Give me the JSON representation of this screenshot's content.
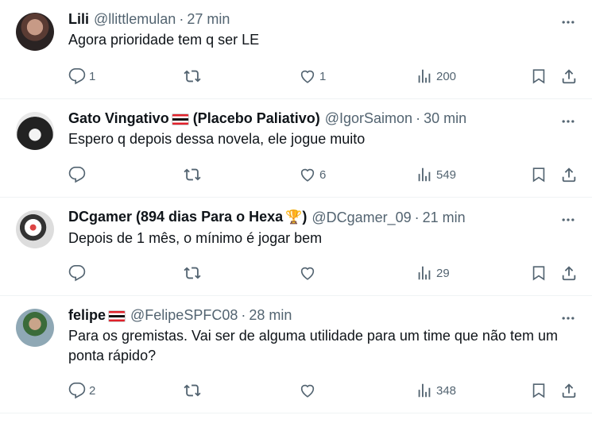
{
  "tweets": [
    {
      "name": "Lili",
      "name_suffix": "",
      "handle": "@llittlemulan",
      "time": "27 min",
      "text": "Agora prioridade tem q ser LE",
      "replies": "1",
      "retweets": "",
      "likes": "1",
      "views": "200",
      "has_flag": false,
      "has_trophy": false
    },
    {
      "name": "Gato Vingativo",
      "name_suffix": " (Placebo Paliativo)",
      "handle": "@IgorSaimon",
      "time": "30 min",
      "text": "Espero q depois dessa novela, ele jogue muito",
      "replies": "",
      "retweets": "",
      "likes": "6",
      "views": "549",
      "has_flag": true,
      "has_trophy": false
    },
    {
      "name": "DCgamer (894 dias Para o Hexa",
      "name_suffix": ")",
      "handle": "@DCgamer_09",
      "time": "21 min",
      "text": "Depois de 1 mês, o mínimo é jogar bem",
      "replies": "",
      "retweets": "",
      "likes": "",
      "views": "29",
      "has_flag": false,
      "has_trophy": true
    },
    {
      "name": "felipe",
      "name_suffix": "",
      "handle": "@FelipeSPFC08",
      "time": "28 min",
      "text": "Para os gremistas. Vai ser de alguma utilidade para um time que não tem um ponta rápido?",
      "replies": "2",
      "retweets": "",
      "likes": "",
      "views": "348",
      "has_flag": true,
      "has_trophy": false
    }
  ],
  "separator": "·",
  "icons": {
    "reply": "reply-icon",
    "retweet": "retweet-icon",
    "like": "heart-icon",
    "views": "views-icon",
    "bookmark": "bookmark-icon",
    "share": "share-icon",
    "more": "more-icon",
    "trophy": "trophy-icon"
  },
  "colors": {
    "text": "#0f1419",
    "secondary": "#536471",
    "border": "#eff3f4"
  }
}
